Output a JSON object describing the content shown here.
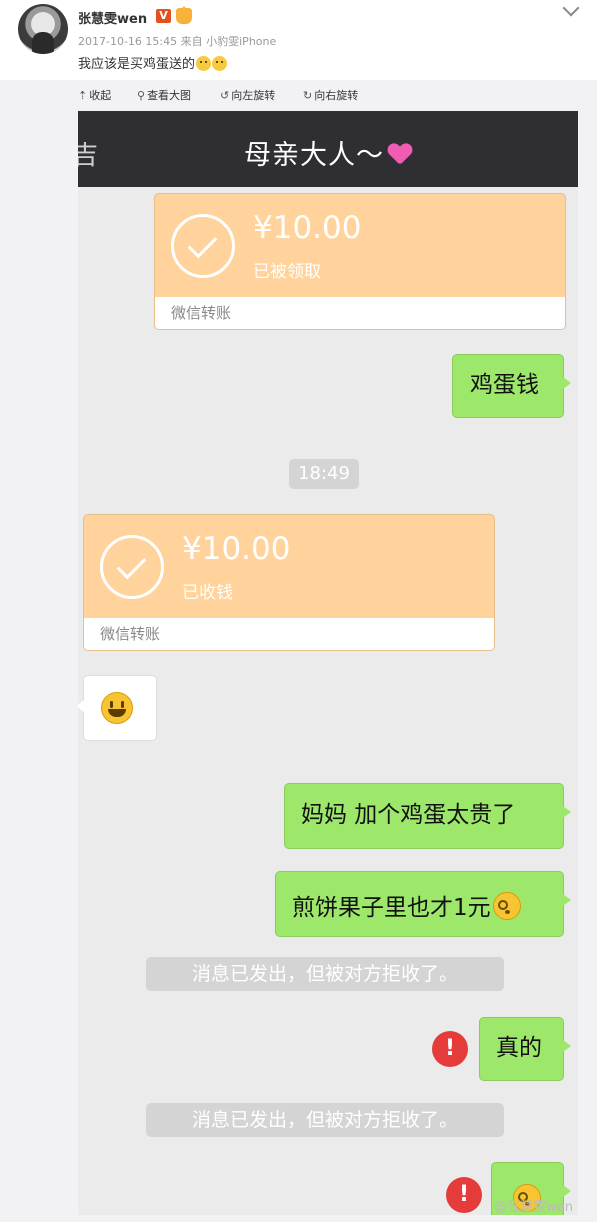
{
  "post": {
    "username": "张慧雯wen",
    "verify_badge": "V",
    "timestamp": "2017-10-16 15:45",
    "source_prefix": "来自",
    "source": "小豹雯iPhone",
    "text": "我应该是买鸡蛋送的"
  },
  "toolbar": {
    "collapse": "收起",
    "view_large": "查看大图",
    "rotate_left": "向左旋转",
    "rotate_right": "向右旋转"
  },
  "chat": {
    "back_glyph": "吉",
    "title": "母亲大人～",
    "transfer_1": {
      "amount": "¥10.00",
      "status": "已被领取",
      "footer": "微信转账"
    },
    "msg_egg_money": "鸡蛋钱",
    "time": "18:49",
    "transfer_2": {
      "amount": "¥10.00",
      "status": "已收钱",
      "footer": "微信转账"
    },
    "msg_egg_expensive": "妈妈 加个鸡蛋太贵了",
    "msg_jianbing": "煎饼果子里也才1元",
    "rejected_1": "消息已发出，但被对方拒收了。",
    "msg_really": "真的",
    "rejected_2": "消息已发出，但被对方拒收了。",
    "error_mark": "!"
  },
  "watermark": "@张慧雯wen",
  "icons": [
    "verified-icon",
    "vip-icon",
    "chevron-down-icon",
    "collapse-icon",
    "magnifier-icon",
    "rotate-left-icon",
    "rotate-right-icon",
    "heart-icon",
    "checkmark-icon",
    "smiley-icon",
    "blush-icon",
    "error-icon"
  ]
}
